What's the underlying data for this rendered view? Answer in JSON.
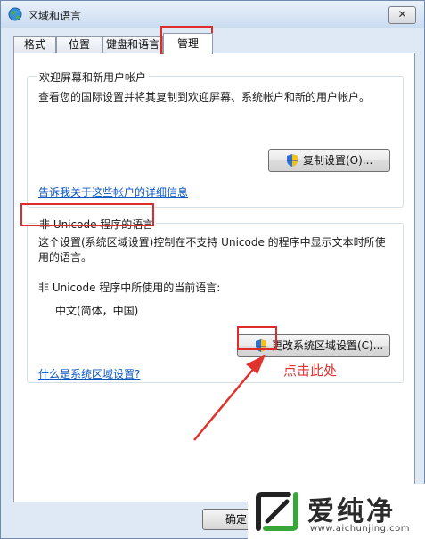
{
  "window": {
    "title": "区域和语言",
    "close_glyph": "✕"
  },
  "tabs": [
    {
      "label": "格式",
      "active": false
    },
    {
      "label": "位置",
      "active": false
    },
    {
      "label": "键盘和语言",
      "active": false
    },
    {
      "label": "管理",
      "active": true
    }
  ],
  "welcome_group": {
    "title": "欢迎屏幕和新用户帐户",
    "description": "查看您的国际设置并将其复制到欢迎屏幕、系统帐户和新的用户帐户。",
    "copy_button": "复制设置(O)...",
    "link": "告诉我关于这些帐户的详细信息"
  },
  "non_unicode_group": {
    "title": "非 Unicode 程序的语言",
    "description_line1": "这个设置(系统区域设置)控制在不支持 Unicode 的程序中显示文本时所使",
    "description_line2": "用的语言。",
    "current_label": "非 Unicode 程序中所使用的当前语言:",
    "current_value": "中文(简体，中国)",
    "change_button": "更改系统区域设置(C)...",
    "link": "什么是系统区域设置?"
  },
  "annotation": {
    "text": "点击此处",
    "color": "#e0332e"
  },
  "footer": {
    "ok_button": "确定"
  },
  "watermark": {
    "brand": "爱纯净",
    "url": "www.aichunjing.com"
  },
  "colors": {
    "accent_link": "#0a56c2",
    "highlight": "#e02b2b"
  },
  "icons": {
    "app": "globe-icon",
    "shield": "uac-shield-icon",
    "close": "close-icon"
  }
}
